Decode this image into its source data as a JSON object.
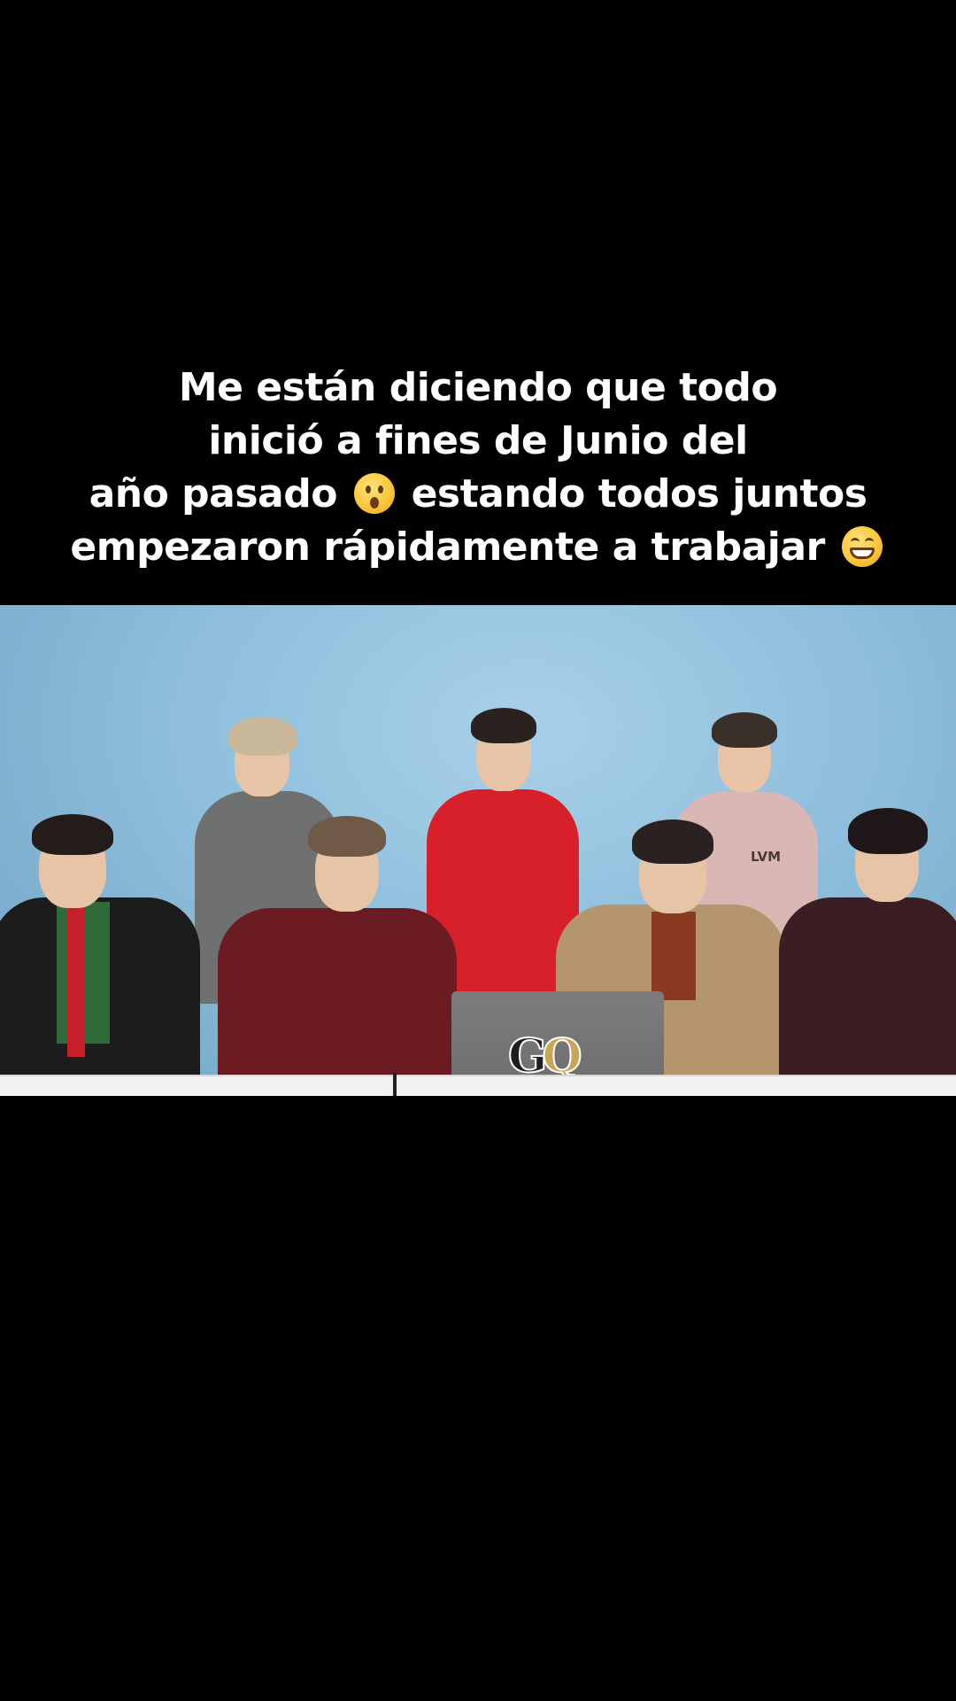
{
  "caption": {
    "line1": "Me están diciendo que todo",
    "line2": "inició a fines de Junio del",
    "line3_before": "año pasado",
    "line3_emoji": "hushed-face-emoji",
    "line3_after": "estando todos juntos",
    "line4_before": "empezaron rápidamente a trabajar",
    "line4_emoji": "grinning-face-emoji"
  },
  "video": {
    "background_color": "#8fbfdc",
    "jacket_logo": "LVM",
    "laptop_logo_g": "G",
    "laptop_logo_q": "Q"
  },
  "colors": {
    "page_background": "#000000",
    "caption_text": "#ffffff",
    "gq_gold": "#c8a657"
  }
}
